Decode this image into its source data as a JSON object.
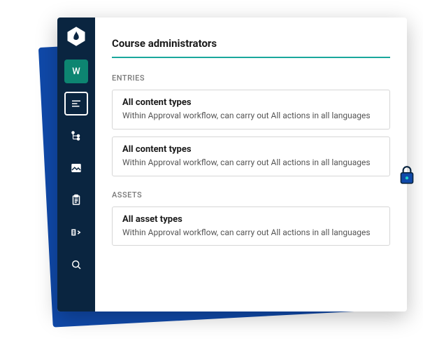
{
  "sidebar": {
    "workspace_letter": "W"
  },
  "page": {
    "title": "Course administrators"
  },
  "sections": [
    {
      "label": "ENTRIES",
      "cards": [
        {
          "title": "All content types",
          "sub": "Within Approval workflow, can carry out All actions in all languages"
        },
        {
          "title": "All content types",
          "sub": "Within Approval workflow, can carry out All actions in all languages"
        }
      ]
    },
    {
      "label": "ASSETS",
      "cards": [
        {
          "title": "All asset types",
          "sub": "Within Approval workflow, can carry out All actions in all languages"
        }
      ]
    }
  ]
}
